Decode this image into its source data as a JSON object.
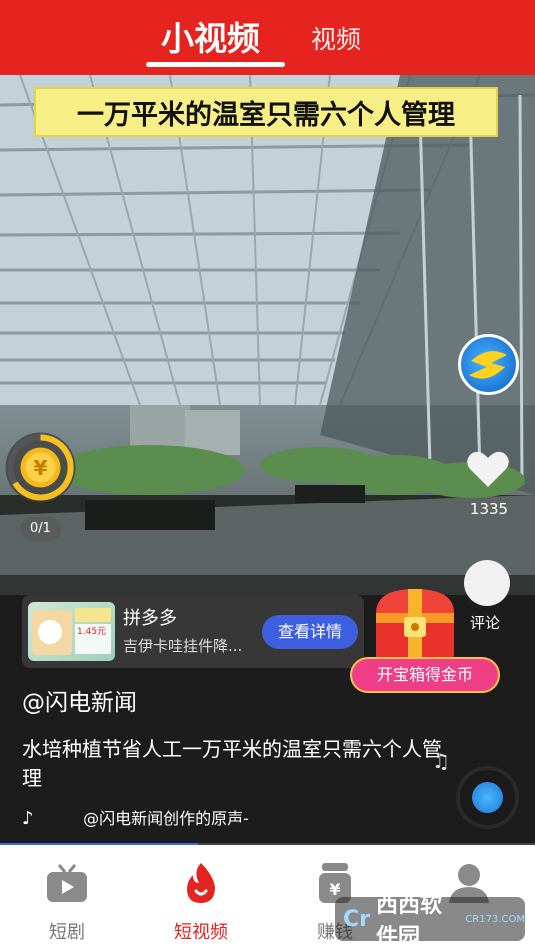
{
  "header": {
    "tabs": [
      {
        "label": "小视频",
        "active": true
      },
      {
        "label": "视频",
        "active": false
      }
    ]
  },
  "video": {
    "caption": "一万平米的温室只需六个人管理",
    "coin_count": "0/1",
    "like_count": "1335",
    "comment_label": "评论",
    "author": "@闪电新闻",
    "description": "水培种植节省人工一万平米的温室只需六个人管理",
    "sound": "@闪电新闻创作的原声-",
    "progress": 0.37
  },
  "ad": {
    "title": "拼多多",
    "description": "吉伊卡哇挂件降...",
    "button": "查看详情",
    "thumb_text": "1.45元"
  },
  "chest": {
    "button": "开宝箱得金币"
  },
  "bottom_nav": {
    "items": [
      {
        "label": "短剧",
        "icon": "tv-icon"
      },
      {
        "label": "短视频",
        "icon": "flame-icon",
        "active": true
      },
      {
        "label": "赚钱",
        "icon": "money-bag-icon"
      },
      {
        "label": "",
        "icon": "user-icon"
      }
    ]
  },
  "watermark": {
    "text": "西西软件园",
    "sub": "CR173.COM",
    "logo": "Cr"
  },
  "colors": {
    "brand_red": "#e5231f",
    "ad_button": "#3d5fe0",
    "chest_button": "#ee3f86"
  }
}
